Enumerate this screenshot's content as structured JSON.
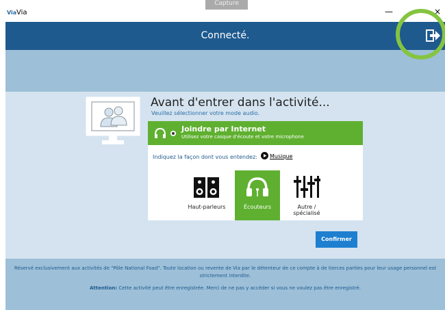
{
  "titlebar": {
    "logo": "Via",
    "title": "Via",
    "minimize": "—",
    "close": "×"
  },
  "overlay": {
    "capture_label": "Capture"
  },
  "header": {
    "title": "Connecté.",
    "exit_icon": "exit-icon"
  },
  "main": {
    "heading": "Avant d'entrer dans l'activité...",
    "subheading": "Veuillez sélectionner votre mode audio.",
    "monitor_icon": "users-monitor-icon",
    "option": {
      "title": "Joindre par Internet",
      "description": "Utilisez votre casque d'écoute et votre microphone",
      "icon": "headset-icon",
      "selected": true
    },
    "prompt": "Indiquez la façon dont vous entendez:",
    "music_link": "Musique",
    "devices": [
      {
        "label": "Haut-parleurs",
        "icon": "speakers-icon",
        "selected": false
      },
      {
        "label": "Écouteurs",
        "icon": "headphones-icon",
        "selected": true
      },
      {
        "label_line1": "Autre /",
        "label_line2": "spécialisé",
        "icon": "mixer-sliders-icon",
        "selected": false
      }
    ],
    "confirm_label": "Confirmer"
  },
  "footer": {
    "disclaimer": "Réservé exclusivement aux activités de \"Pôle National Foad\". Toute location ou revente de Via par le détenteur de ce compte à de tierces parties pour leur usage personnel est strictement interdite.",
    "attention_label": "Attention:",
    "attention_text": " Cette activité peut être enregistrée. Merci de ne pas y accéder si vous ne voulez pas être enregistré."
  },
  "colors": {
    "header": "#1e5a8e",
    "band": "#9dbfd8",
    "content": "#d4e3ef",
    "accent_green": "#5fb030",
    "confirm_button": "#1e7fd0",
    "highlight_ring": "#84c441"
  }
}
